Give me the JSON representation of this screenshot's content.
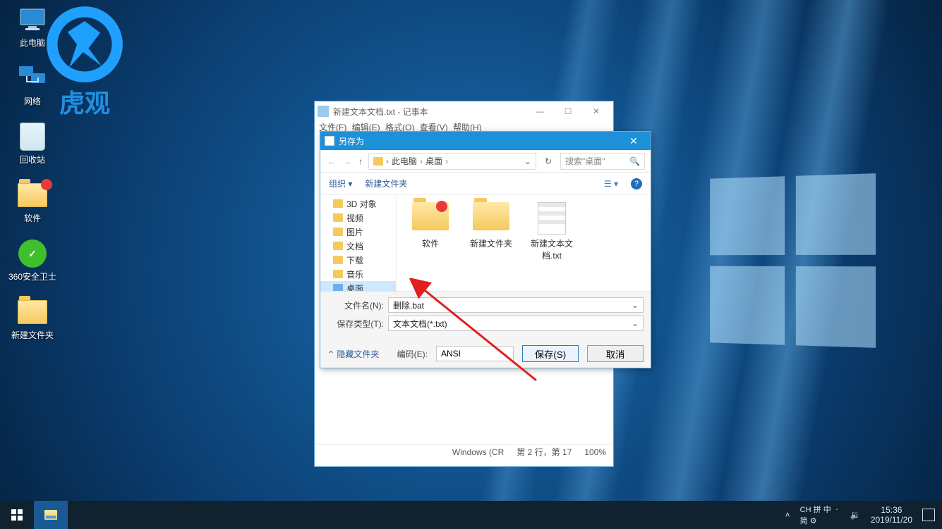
{
  "desktop": {
    "icons": [
      {
        "label": "此电脑"
      },
      {
        "label": "网络"
      },
      {
        "label": "回收站"
      },
      {
        "label": "软件"
      },
      {
        "label": "360安全卫士"
      },
      {
        "label": "新建文件夹"
      }
    ]
  },
  "watermark_text": "虎观",
  "notepad": {
    "title": "新建文本文档.txt - 记事本",
    "menus": [
      "文件(F)",
      "编辑(E)",
      "格式(O)",
      "查看(V)",
      "帮助(H)"
    ],
    "status_left": "Windows (CR",
    "status_mid": "第 2 行，第 17",
    "status_right": "100%"
  },
  "save_dialog": {
    "title": "另存为",
    "crumb": [
      "此电脑",
      "桌面"
    ],
    "search_placeholder": "搜索\"桌面\"",
    "toolbar": {
      "organize": "组织",
      "new_folder": "新建文件夹"
    },
    "tree": [
      {
        "label": "3D 对象"
      },
      {
        "label": "视频"
      },
      {
        "label": "图片"
      },
      {
        "label": "文档"
      },
      {
        "label": "下载"
      },
      {
        "label": "音乐"
      },
      {
        "label": "桌面",
        "selected": true
      }
    ],
    "files": [
      {
        "label": "软件",
        "type": "folder",
        "badge": true
      },
      {
        "label": "新建文件夹",
        "type": "folder"
      },
      {
        "label": "新建文本文档.txt",
        "type": "txt"
      }
    ],
    "filename_label": "文件名(N):",
    "filename_value": "删除.bat",
    "type_label": "保存类型(T):",
    "type_value": "文本文档(*.txt)",
    "hide_folders": "隐藏文件夹",
    "encoding_label": "编码(E):",
    "encoding_value": "ANSI",
    "save_btn": "保存(S)",
    "cancel_btn": "取消"
  },
  "taskbar": {
    "ime": {
      "lang": "CH",
      "method": "拼",
      "half": "中",
      "punct": "ㆍ"
    },
    "ime2": "简 ⚙",
    "time": "15:36",
    "date": "2019/11/20"
  }
}
